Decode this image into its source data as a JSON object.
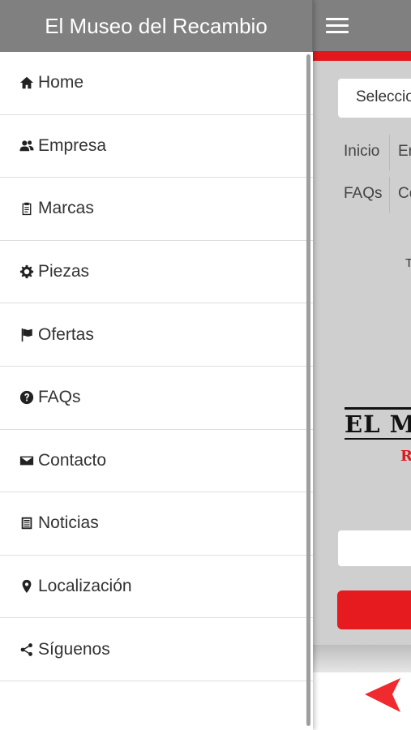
{
  "app": {
    "title": "El Museo del Recambio"
  },
  "menu": {
    "items": [
      {
        "label": "Home",
        "icon": "home-icon"
      },
      {
        "label": "Empresa",
        "icon": "users-icon"
      },
      {
        "label": "Marcas",
        "icon": "clipboard-icon"
      },
      {
        "label": "Piezas",
        "icon": "gear-icon"
      },
      {
        "label": "Ofertas",
        "icon": "flag-icon"
      },
      {
        "label": "FAQs",
        "icon": "question-circle-icon"
      },
      {
        "label": "Contacto",
        "icon": "envelope-icon"
      },
      {
        "label": "Noticias",
        "icon": "newspaper-icon"
      },
      {
        "label": "Localización",
        "icon": "map-marker-icon"
      },
      {
        "label": "Síguenos",
        "icon": "share-icon"
      }
    ]
  },
  "background_page": {
    "select_text": "Seleccio",
    "nav_row1": [
      "Inicio",
      "Er"
    ],
    "nav_row2": [
      "FAQs",
      "Co"
    ],
    "tagline_fragment": "T",
    "logo_text": "EL M",
    "logo_sub": "R"
  },
  "colors": {
    "header_gray": "#808080",
    "accent_red": "#e3171c",
    "page_gray": "#cfcfcf"
  }
}
